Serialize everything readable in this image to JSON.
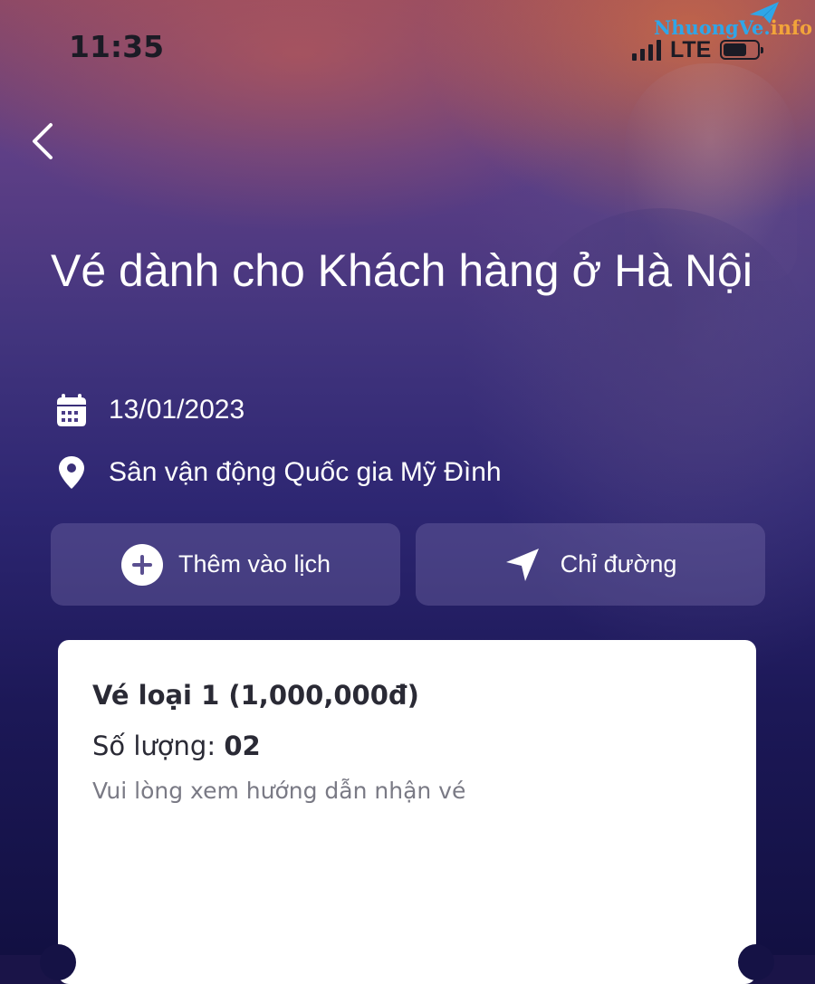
{
  "status_bar": {
    "time": "11:35",
    "network": "LTE",
    "signal_bars": 4,
    "battery_level": 0.7
  },
  "watermark": {
    "main": "NhuongVe",
    "dot": ".",
    "suffix": "info"
  },
  "event": {
    "title": "Vé dành cho Khách hàng ở Hà Nội",
    "date": "13/01/2023",
    "location": "Sân vận động Quốc gia Mỹ Đình"
  },
  "actions": {
    "add_calendar_label": "Thêm vào lịch",
    "directions_label": "Chỉ đường"
  },
  "ticket": {
    "name": "Vé loại 1 (1,000,000đ)",
    "quantity_label": "Số lượng:",
    "quantity_value": "02",
    "note": "Vui lòng xem hướng dẫn nhận vé"
  },
  "icons": {
    "back": "chevron-left-icon",
    "date": "calendar-icon",
    "location": "map-pin-icon",
    "add": "plus-circle-icon",
    "directions": "navigation-arrow-icon"
  },
  "colors": {
    "background_top": "#8a4868",
    "background_bottom": "#121042",
    "button_bg": "rgba(120,110,170,0.38)",
    "card_bg": "#ffffff",
    "text_primary": "#2a2a35",
    "text_secondary": "#7a7a85"
  }
}
